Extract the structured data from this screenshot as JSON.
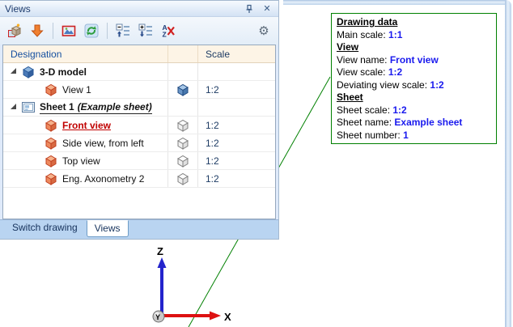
{
  "panel": {
    "title": "Views",
    "titlebar_icons": [
      "pin-icon",
      "close-icon"
    ],
    "toolbar_icons": [
      "create-view",
      "insert-view",
      "view-properties",
      "refresh-views",
      "collapse-all",
      "expand-all",
      "sorting-off",
      "settings-gear"
    ],
    "sorting_letters": {
      "top": "A",
      "bottom": "Z"
    }
  },
  "table": {
    "columns": {
      "designation": "Designation",
      "scale": "Scale"
    },
    "rows": [
      {
        "type": "group",
        "icon": "model-3d-cube-blue",
        "label": "3-D model"
      },
      {
        "type": "view",
        "icon": "view-cube-orange",
        "label": "View 1",
        "marker": "cube-blue",
        "scale": "1:2"
      },
      {
        "type": "group",
        "icon": "sheet",
        "label": "Sheet 1",
        "suffix": "(Example sheet)"
      },
      {
        "type": "view",
        "icon": "view-cube-orange",
        "label": "Front view",
        "marker": "cube-outline",
        "scale": "1:2",
        "state": "current"
      },
      {
        "type": "view",
        "icon": "view-cube-orange",
        "label": "Side view, from left",
        "marker": "cube-outline",
        "scale": "1:2"
      },
      {
        "type": "view",
        "icon": "view-cube-orange",
        "label": "Top view",
        "marker": "cube-outline",
        "scale": "1:2"
      },
      {
        "type": "view",
        "icon": "view-cube-orange",
        "label": "Eng. Axonometry 2",
        "marker": "cube-outline",
        "scale": "1:2"
      }
    ]
  },
  "tabs": [
    {
      "label": "Switch drawing",
      "active": false
    },
    {
      "label": "Views",
      "active": true
    }
  ],
  "tooltip": {
    "title": "Drawing data",
    "rows": [
      {
        "label": "Main scale: ",
        "value": "1:1"
      },
      {
        "heading": "View"
      },
      {
        "label": "View name: ",
        "value": "Front view"
      },
      {
        "label": "View scale: ",
        "value": "1:2"
      },
      {
        "label": "Deviating view scale: ",
        "value": "1:2"
      },
      {
        "heading": "Sheet"
      },
      {
        "label": "Sheet scale: ",
        "value": "1:2"
      },
      {
        "label": "Sheet name: ",
        "value": "Example sheet"
      },
      {
        "label": "Sheet number: ",
        "value": "1"
      }
    ]
  },
  "axes": {
    "x_label": "X",
    "y_label": "Y",
    "z_label": "Z"
  },
  "colors": {
    "annotation_green": "#008000",
    "value_blue": "#1a1aee",
    "current_view_red": "#c00000",
    "x_axis_red": "#dd1111",
    "z_axis_blue": "#2424cc",
    "header_blue": "#1550a0"
  }
}
